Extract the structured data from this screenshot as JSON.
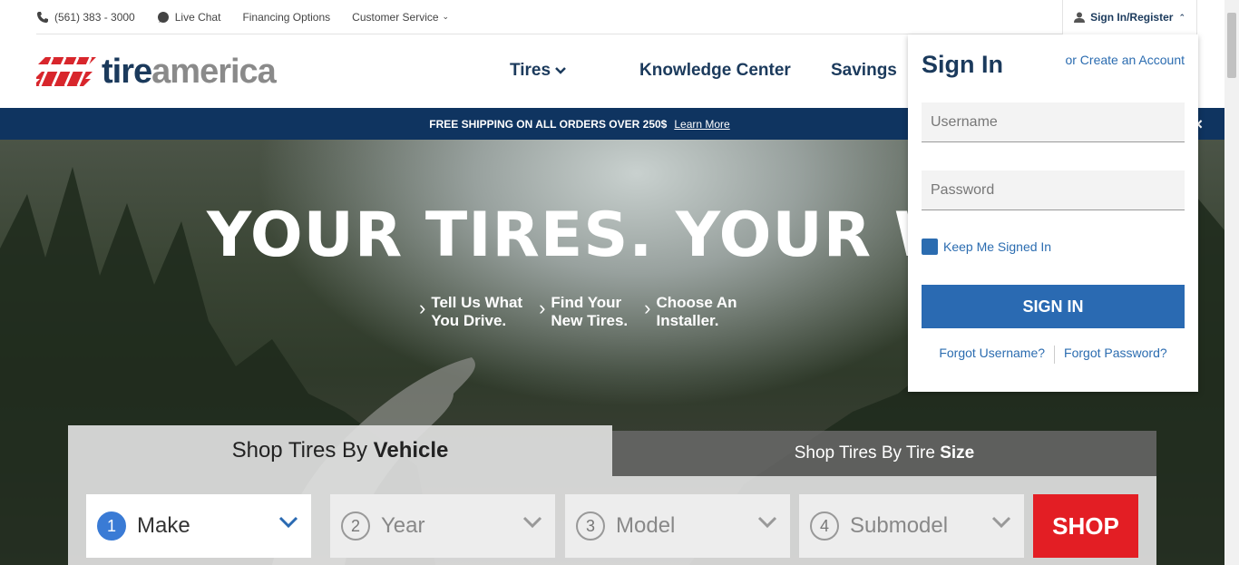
{
  "topbar": {
    "phone": "(561) 383 - 3000",
    "live_chat": "Live Chat",
    "financing": "Financing Options",
    "customer_service": "Customer Service",
    "signin_register": "Sign In/Register"
  },
  "header": {
    "logo_part1": "tire",
    "logo_part2": "america",
    "nav": {
      "tires": "Tires",
      "knowledge_center": "Knowledge Center",
      "savings": "Savings"
    }
  },
  "promo": {
    "text": "FREE SHIPPING ON ALL ORDERS OVER 250$",
    "link": "Learn More",
    "close": "×"
  },
  "hero": {
    "title": "YOUR TIRES. YOUR W",
    "steps": [
      "Tell Us What\nYou Drive.",
      "Find Your\nNew Tires.",
      "Choose An\nInstaller."
    ]
  },
  "shop": {
    "tab_vehicle_prefix": "Shop Tires By ",
    "tab_vehicle_bold": "Vehicle",
    "tab_size_prefix": "Shop Tires By Tire ",
    "tab_size_bold": "Size",
    "selects": [
      {
        "num": "1",
        "label": "Make"
      },
      {
        "num": "2",
        "label": "Year"
      },
      {
        "num": "3",
        "label": "Model"
      },
      {
        "num": "4",
        "label": "Submodel"
      }
    ],
    "shop_button": "SHOP"
  },
  "signin": {
    "title": "Sign In",
    "create_account": "or Create an Account",
    "username_placeholder": "Username",
    "password_placeholder": "Password",
    "keep_signed_in": "Keep Me Signed In",
    "button": "SIGN IN",
    "forgot_username": "Forgot Username?",
    "forgot_password": "Forgot Password?"
  },
  "colors": {
    "brand_navy": "#1b3a5c",
    "promo_bg": "#0f3460",
    "accent_blue": "#2a6ab2",
    "shop_red": "#e31e24"
  }
}
